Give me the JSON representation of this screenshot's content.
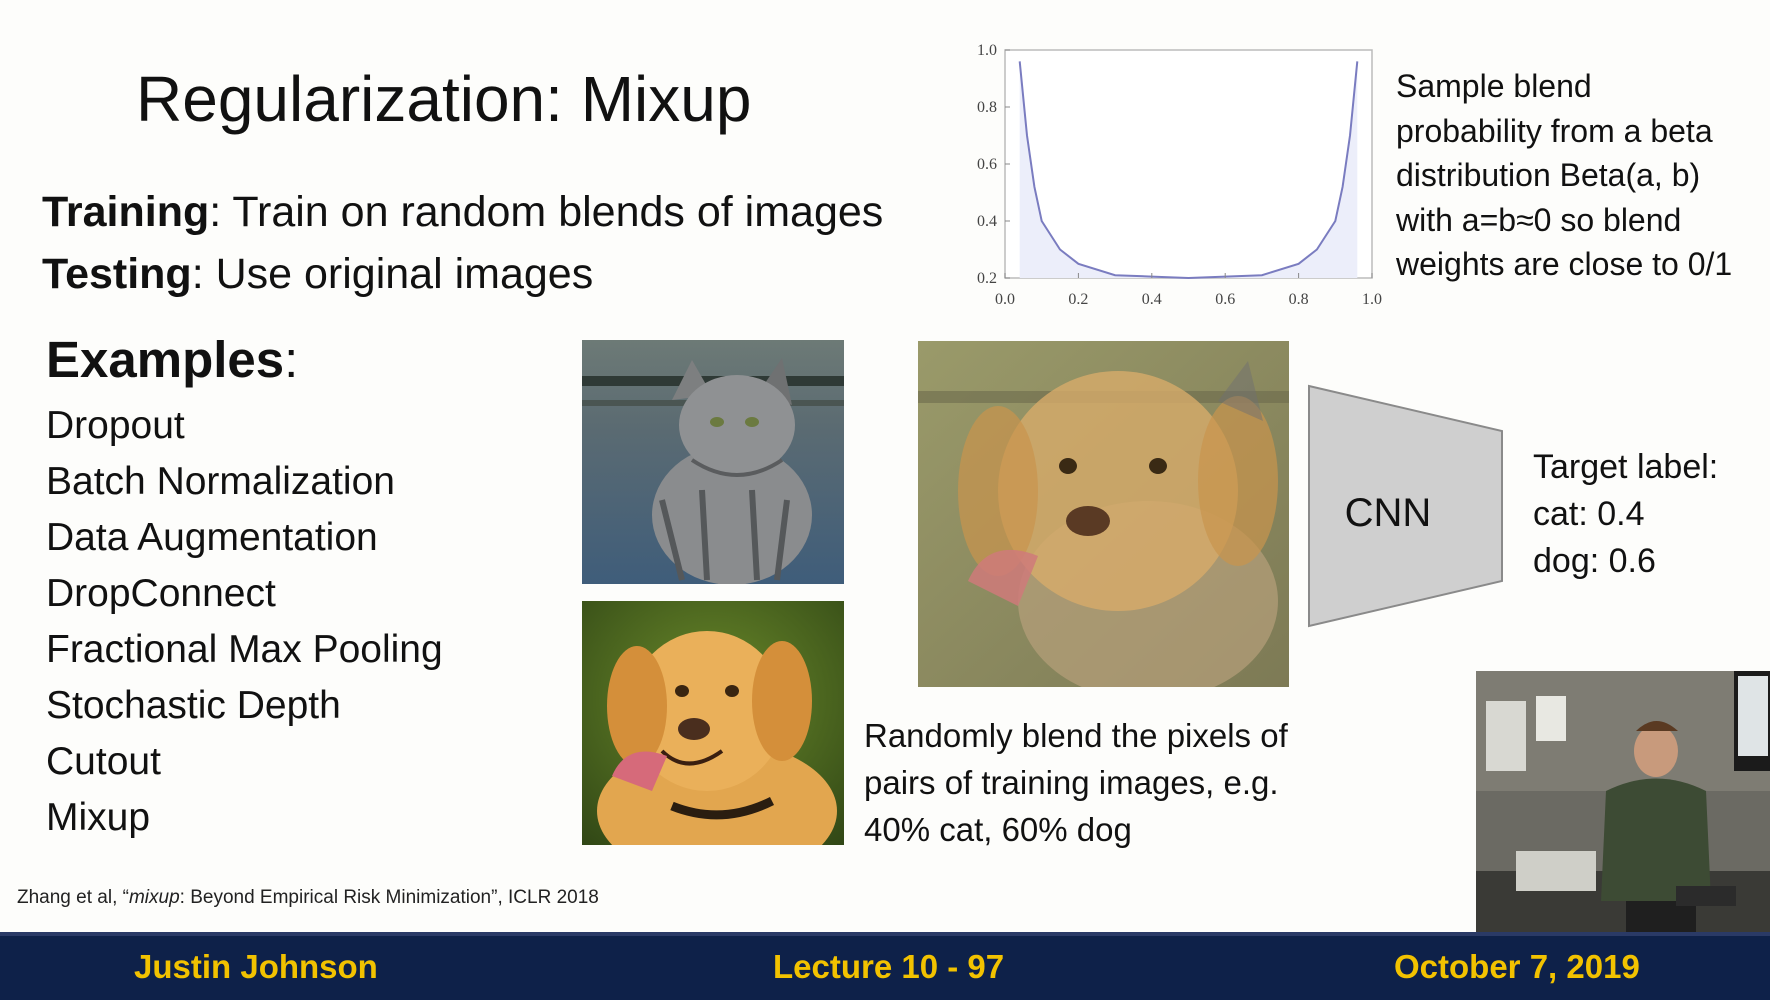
{
  "slide": {
    "title": "Regularization: Mixup",
    "training": {
      "label": "Training",
      "text": ": Train on random blends of images"
    },
    "testing": {
      "label": "Testing",
      "text": ": Use original images"
    },
    "examples": {
      "heading": "Examples",
      "colon": ":",
      "items": [
        "Dropout",
        "Batch Normalization",
        "Data Augmentation",
        "DropConnect",
        "Fractional Max Pooling",
        "Stochastic Depth",
        "Cutout",
        "Mixup"
      ]
    },
    "chart_note": [
      "Sample blend",
      "probability from a beta",
      "distribution Beta(a, b)",
      "with a=b≈0 so blend",
      "weights are close to 0/1"
    ],
    "cnn_label": "CNN",
    "target": [
      "Target label:",
      "cat: 0.4",
      "dog: 0.6"
    ],
    "caption": [
      "Randomly blend the pixels of",
      "pairs of training images, e.g.",
      "40% cat, 60% dog"
    ],
    "citation": {
      "prefix": "Zhang et al, “",
      "italic": "mixup",
      "suffix": ": Beyond Empirical Risk Minimization”, ICLR 2018"
    }
  },
  "footer": {
    "left": "Justin Johnson",
    "center": "Lecture 10 - 97",
    "right": "October 7, 2019"
  },
  "colors": {
    "footer_bg": "#0e2149",
    "footer_text": "#f2c200",
    "curve": "#7a7cc0",
    "curve_fill": "#eceefa"
  },
  "chart_data": {
    "type": "line",
    "x_ticks": [
      "0.0",
      "0.2",
      "0.4",
      "0.6",
      "0.8",
      "1.0"
    ],
    "y_ticks": [
      "0.2",
      "0.4",
      "0.6",
      "0.8",
      "1.0"
    ],
    "xlim": [
      0,
      1
    ],
    "ylim": [
      0.2,
      1.0
    ],
    "grid": false,
    "series": [
      {
        "x": [
          0.04,
          0.06,
          0.08,
          0.1,
          0.15,
          0.2,
          0.3,
          0.4,
          0.5,
          0.6,
          0.7,
          0.8,
          0.85,
          0.9,
          0.92,
          0.94,
          0.96
        ],
        "y": [
          0.96,
          0.7,
          0.52,
          0.4,
          0.3,
          0.25,
          0.21,
          0.205,
          0.2,
          0.205,
          0.21,
          0.25,
          0.3,
          0.4,
          0.52,
          0.7,
          0.96
        ]
      }
    ]
  }
}
